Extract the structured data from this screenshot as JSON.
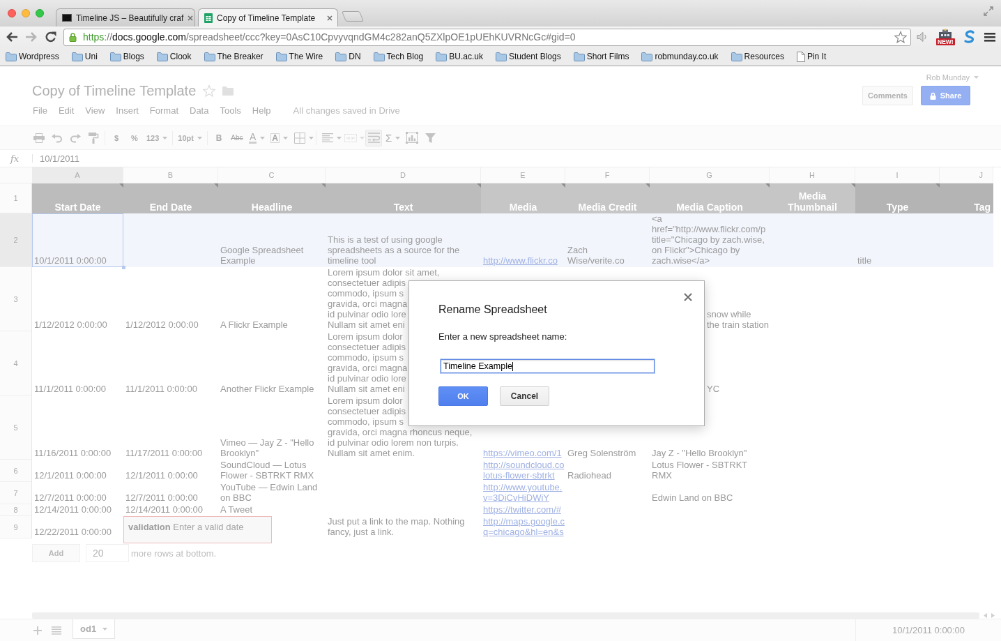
{
  "browser": {
    "tabs": [
      {
        "title": "Timeline JS – Beautifully craf",
        "kind": "site",
        "selected": false
      },
      {
        "title": "Copy of Timeline Template",
        "kind": "spreadsheet",
        "selected": true
      }
    ],
    "address_bar": [
      {
        "kind": "scheme",
        "text": "https"
      },
      {
        "kind": "plain",
        "text": "://"
      },
      {
        "kind": "host",
        "text": "docs.google.com"
      },
      {
        "kind": "path",
        "text": "/spreadsheet/ccc?key=0AsC10CpvyvqndGM4c282anQ5ZXlpOE1pUEhKUVRNcGc#gid=0"
      }
    ],
    "extension_badge": "NEW!",
    "bookmarks": [
      {
        "label": "Wordpress",
        "kind": "folder"
      },
      {
        "label": "Uni",
        "kind": "folder"
      },
      {
        "label": "Blogs",
        "kind": "folder"
      },
      {
        "label": "Clook",
        "kind": "folder"
      },
      {
        "label": "The Breaker",
        "kind": "folder"
      },
      {
        "label": "The Wire",
        "kind": "folder"
      },
      {
        "label": "DN",
        "kind": "folder"
      },
      {
        "label": "Tech Blog",
        "kind": "folder"
      },
      {
        "label": "BU.ac.uk",
        "kind": "folder"
      },
      {
        "label": "Student Blogs",
        "kind": "folder"
      },
      {
        "label": "Short Films",
        "kind": "folder"
      },
      {
        "label": "robmunday.co.uk",
        "kind": "folder"
      },
      {
        "label": "Resources",
        "kind": "folder"
      },
      {
        "label": "Pin It",
        "kind": "page"
      }
    ]
  },
  "document": {
    "account": "Rob Munday",
    "title": "Copy of Timeline Template",
    "menu": [
      "File",
      "Edit",
      "View",
      "Insert",
      "Format",
      "Data",
      "Tools",
      "Help"
    ],
    "save_status": "All changes saved in Drive",
    "comments_button": "Comments",
    "share_button": "Share"
  },
  "toolbar": {
    "currency": "$",
    "percent": "%",
    "number_format": "123",
    "font_size": "10pt",
    "bold": "B",
    "strikethrough": "Abc",
    "text_color": "A",
    "fill_color": "A",
    "functions": "Σ",
    "wrap_on": true
  },
  "formula_bar": {
    "label": "fx",
    "value": "10/1/2011"
  },
  "sheet": {
    "columns": [
      {
        "letter": "A",
        "header": "Start Date",
        "kind": "text",
        "color": "#bcbcbc",
        "note": true,
        "selected": true
      },
      {
        "letter": "B",
        "header": "End Date",
        "kind": "text",
        "color": "#bcbcbc",
        "note": true,
        "selected": false
      },
      {
        "letter": "C",
        "header": "Headline",
        "kind": "text",
        "color": "#bcbcbc",
        "note": true,
        "selected": false
      },
      {
        "letter": "D",
        "header": "Text",
        "kind": "text",
        "color": "#bcbcbc",
        "note": true,
        "selected": false
      },
      {
        "letter": "E",
        "header": "Media",
        "kind": "link",
        "color": "#c6c6c6",
        "note": true,
        "selected": false
      },
      {
        "letter": "F",
        "header": "Media Credit",
        "kind": "text",
        "color": "#c6c6c6",
        "note": true,
        "selected": false
      },
      {
        "letter": "G",
        "header": "Media Caption",
        "kind": "text",
        "color": "#c6c6c6",
        "note": true,
        "selected": false
      },
      {
        "letter": "H",
        "header": "Media Thumbnail",
        "kind": "text",
        "color": "#c6c6c6",
        "note": true,
        "selected": false
      },
      {
        "letter": "I",
        "header": "Type",
        "kind": "text",
        "color": "#b4b4b4",
        "note": true,
        "selected": false
      },
      {
        "letter": "J",
        "header": "Tag",
        "kind": "text",
        "color": "#b4b4b4",
        "note": false,
        "selected": false
      }
    ],
    "header_row": "1",
    "rows": [
      {
        "number": "2",
        "selected": true,
        "start_date": "10/1/2011 0:00:00",
        "headline": "Google Spreadsheet\nExample",
        "text": "This is a test of using google\nspreadsheets as a source for the\ntimeline tool",
        "media": "http://www.flickr.co",
        "media_credit": "Zach\nWise/verite.co",
        "media_caption": "<a\nhref=\"http://www.flickr.com/p\ntitle=\"Chicago by zach.wise,\non Flickr\">Chicago by\nzach.wise</a>",
        "type": "title"
      },
      {
        "number": "3",
        "selected": false,
        "start_date": "1/12/2012 0:00:00",
        "end_date": "1/12/2012 0:00:00",
        "headline": "A Flickr Example",
        "text": [
          "Lorem ipsum dolor sit amet,",
          "consectetuer adipis\ncommodo, ipsum s\ngravida, orci magna\nid pulvinar odio lore\nNullam sit amet eni"
        ],
        "media_caption": "snow while\nthe train station"
      },
      {
        "number": "4",
        "selected": false,
        "start_date": "11/1/2011 0:00:00",
        "end_date": "11/1/2011 0:00:00",
        "headline": "Another Flickr Example",
        "text": "Lorem ipsum dolor\nconsectetuer adipis\ncommodo, ipsum s\ngravida, orci magna\nid pulvinar odio lore\nNullam sit amet eni",
        "media_caption": "YC"
      },
      {
        "number": "5",
        "selected": false,
        "start_date": "11/16/2011 0:00:00",
        "end_date": "11/17/2011 0:00:00",
        "headline": "Vimeo — Jay Z - \"Hello\nBrooklyn\"",
        "text": [
          "Lorem ipsum dolor\nconsectetuer adipis\ncommodo, ipsum s",
          "gravida, orci magna rhoncus neque,\nid pulvinar odio lorem non turpis.\nNullam sit amet enim."
        ],
        "media": "https://vimeo.com/1",
        "media_credit": "Greg Solenström",
        "media_caption": "Jay Z - \"Hello Brooklyn\""
      },
      {
        "number": "6",
        "selected": false,
        "start_date": "12/1/2011 0:00:00",
        "end_date": "12/1/2011 0:00:00",
        "headline": "SoundCloud — Lotus\nFlower - SBTRKT RMX",
        "media": "http://soundcloud.co\nlotus-flower-sbtrkt",
        "media_credit": "Radiohead",
        "media_caption": "Lotus Flower - SBTRKT\nRMX"
      },
      {
        "number": "7",
        "selected": false,
        "start_date": "12/7/2011 0:00:00",
        "end_date": "12/7/2011 0:00:00",
        "headline": "YouTube — Edwin Land\non BBC",
        "media": "http://www.youtube.\nv=3DiCvHiDWiY",
        "media_caption": "Edwin Land on BBC"
      },
      {
        "number": "8",
        "selected": false,
        "start_date": "12/14/2011 0:00:00",
        "end_date": "12/14/2011 0:00:00",
        "headline": "A Tweet",
        "media": "https://twitter.com/#"
      },
      {
        "number": "9",
        "selected": false,
        "start_date": "12/22/2011 0:00:00",
        "text": "Just put a link to the map. Nothing\nfancy, just a link.",
        "media": "http://maps.google.c\nq=chicago&hl=en&s"
      }
    ],
    "add_rows": {
      "button": "Add",
      "count": "20",
      "suffix": "more rows at bottom."
    },
    "validation": "**validation** Enter a valid date"
  },
  "sheet_tabs": [
    {
      "label": "od1",
      "selected": true
    }
  ],
  "status": "10/1/2011 0:00:00",
  "dialog": {
    "title": "Rename Spreadsheet",
    "label": "Enter a new spreadsheet name:",
    "value": "Timeline Example",
    "buttons": [
      {
        "label": "OK",
        "kind": "primary"
      },
      {
        "label": "Cancel",
        "kind": "secondary"
      }
    ]
  }
}
